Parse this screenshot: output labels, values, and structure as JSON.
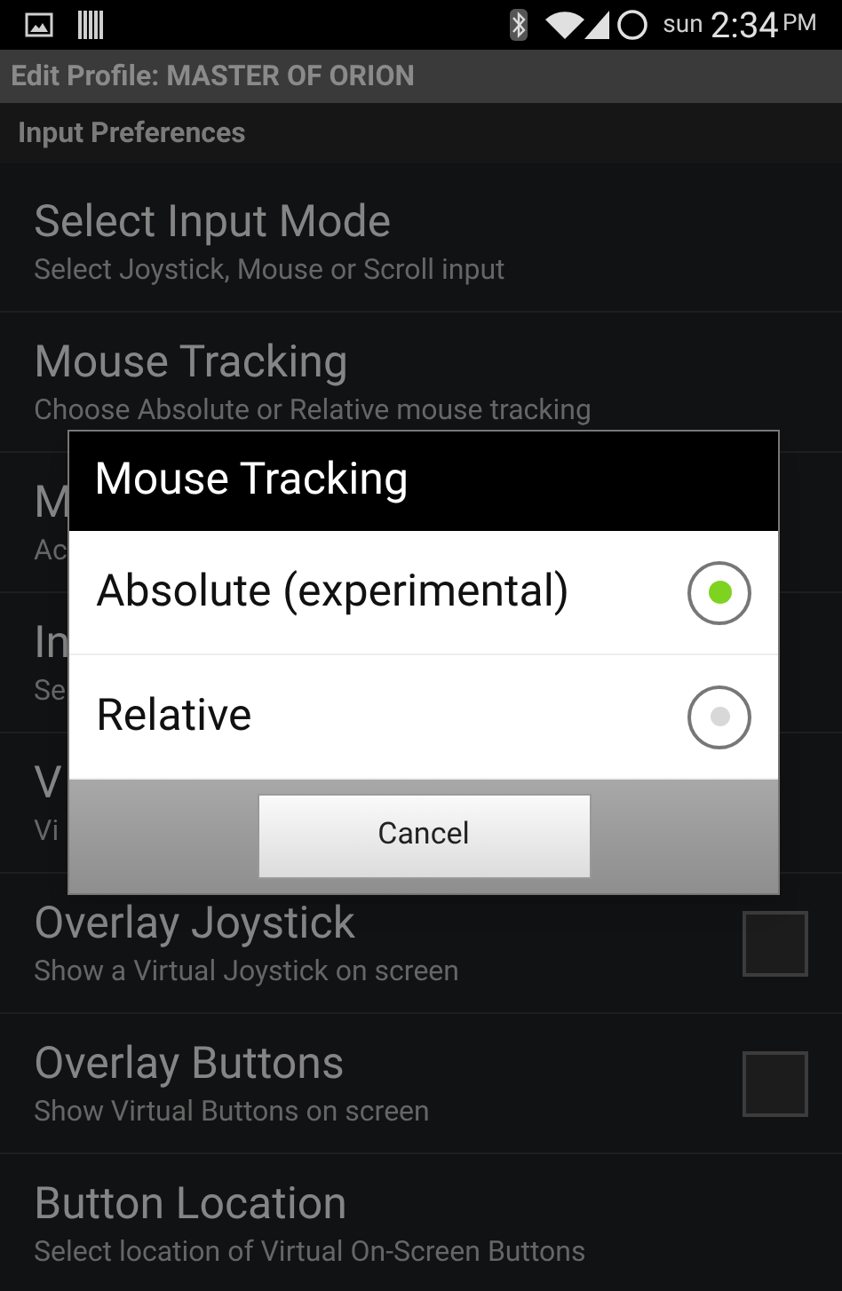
{
  "status_bar": {
    "day": "sun",
    "time": "2:34",
    "ampm": "PM"
  },
  "title_bar": {
    "title": "Edit Profile: MASTER OF ORION"
  },
  "section_header": "Input Preferences",
  "preferences": [
    {
      "kind": "plain",
      "title": "Select Input Mode",
      "summary": "Select Joystick, Mouse or Scroll input"
    },
    {
      "kind": "plain",
      "title": "Mouse Tracking",
      "summary": "Choose Absolute or Relative mouse tracking"
    },
    {
      "kind": "plain",
      "title": "M",
      "summary": "Ac"
    },
    {
      "kind": "plain",
      "title": "In",
      "summary": "Se"
    },
    {
      "kind": "plain",
      "title": "V",
      "summary": "Vi"
    },
    {
      "kind": "checkbox",
      "title": "Overlay Joystick",
      "summary": "Show a Virtual Joystick on screen",
      "checked": false
    },
    {
      "kind": "checkbox",
      "title": "Overlay Buttons",
      "summary": "Show Virtual Buttons on screen",
      "checked": false
    },
    {
      "kind": "plain",
      "title": "Button Location",
      "summary": "Select location of Virtual On-Screen Buttons"
    }
  ],
  "dialog": {
    "title": "Mouse Tracking",
    "options": [
      {
        "label": "Absolute (experimental)",
        "selected": true
      },
      {
        "label": "Relative",
        "selected": false
      }
    ],
    "button": "Cancel"
  }
}
